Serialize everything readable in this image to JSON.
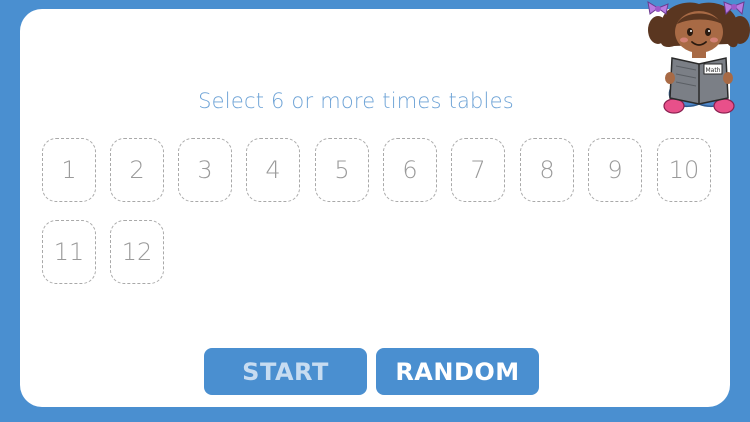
{
  "prompt_text": "Select 6 or more times tables",
  "tables": [
    "1",
    "2",
    "3",
    "4",
    "5",
    "6",
    "7",
    "8",
    "9",
    "10",
    "11",
    "12"
  ],
  "buttons": {
    "start_label": "START",
    "random_label": "RANDOM"
  },
  "mascot": {
    "book_label": "Math",
    "icon": "girl-reading-book"
  },
  "colors": {
    "frame": "#4a8fd0",
    "prompt": "#6ea3d6",
    "tile_border": "#a9a9a9",
    "tile_text": "#9a9a9a",
    "start_text_disabled": "#c7dcf1",
    "random_text": "#ffffff"
  }
}
